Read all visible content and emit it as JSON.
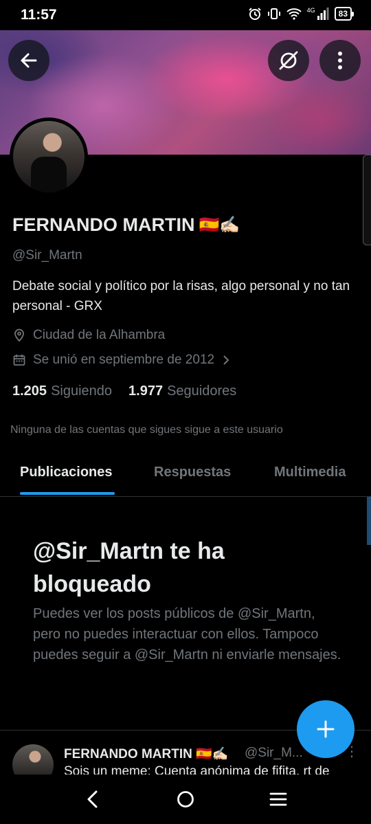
{
  "status_bar": {
    "time": "11:57",
    "network": "4G",
    "battery": "83"
  },
  "header": {
    "back_icon": "arrow-left-icon",
    "grok_icon": "grok-icon",
    "more_icon": "more-vertical-icon"
  },
  "profile": {
    "name": "FERNANDO MARTIN",
    "name_emoji": "🇪🇸✍🏻",
    "handle": "@Sir_Martn",
    "bio": "Debate social y político por la risas, algo personal y no tan personal - GRX",
    "location": "Ciudad de la Alhambra",
    "joined": "Se unió en septiembre de 2012",
    "following_count": "1.205",
    "following_label": "Siguiendo",
    "followers_count": "1.977",
    "followers_label": "Seguidores",
    "mutual_text": "Ninguna de las cuentas que sigues sigue a este usuario"
  },
  "tabs": [
    {
      "label": "Publicaciones",
      "active": true
    },
    {
      "label": "Respuestas",
      "active": false
    },
    {
      "label": "Multimedia",
      "active": false
    }
  ],
  "blocked": {
    "title": "@Sir_Martn te ha bloqueado",
    "description": "Puedes ver los posts públicos de @Sir_Martn, pero no puedes interactuar con ellos. Tampoco puedes seguir a @Sir_Martn ni enviarle mensajes."
  },
  "post": {
    "author": "FERNANDO MARTIN 🇪🇸✍🏻",
    "handle": "@Sir_M...",
    "text": "Sois un meme: Cuenta anónima de fifita, rt de"
  },
  "colors": {
    "accent": "#1d9bf0",
    "background": "#000000",
    "secondary_text": "#71767b",
    "primary_text": "#e7e9ea"
  }
}
